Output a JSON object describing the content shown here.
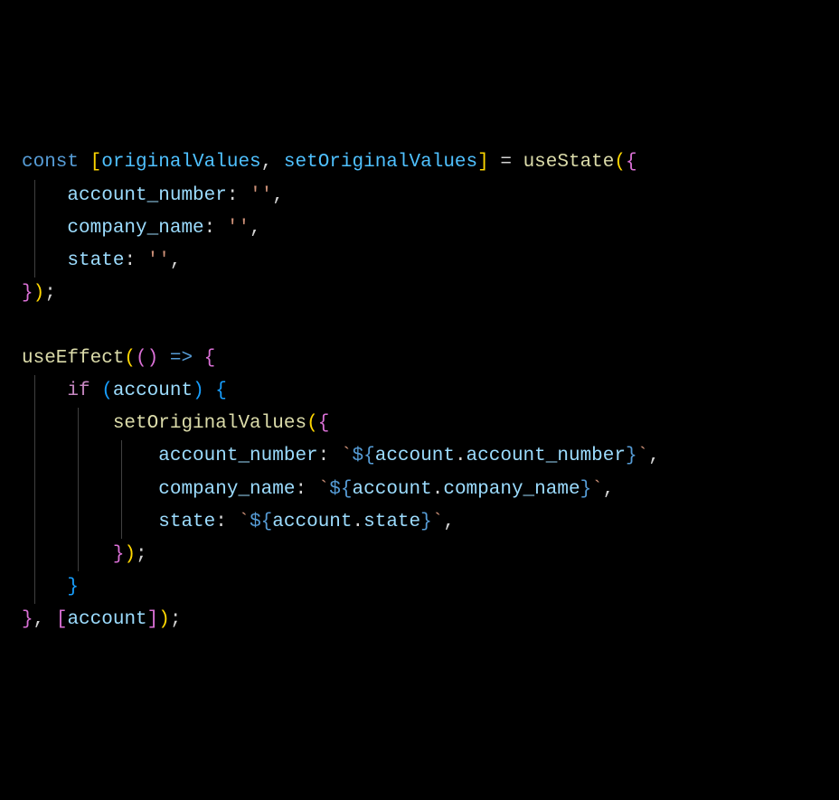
{
  "code": {
    "line1": {
      "kw_const": "const",
      "bracket_open": "[",
      "var1": "originalValues",
      "comma": ", ",
      "var2": "setOriginalValues",
      "bracket_close": "]",
      "equals": " = ",
      "func": "useState",
      "paren_open": "(",
      "brace_open": "{"
    },
    "line2": {
      "prop": "account_number",
      "colon": ": ",
      "val": "''",
      "comma": ","
    },
    "line3": {
      "prop": "company_name",
      "colon": ": ",
      "val": "''",
      "comma": ","
    },
    "line4": {
      "prop": "state",
      "colon": ": ",
      "val": "''",
      "comma": ","
    },
    "line5": {
      "brace_close": "}",
      "paren_close": ")",
      "semi": ";"
    },
    "line7": {
      "func": "useEffect",
      "paren_open": "(",
      "paren2_open": "(",
      "paren2_close": ")",
      "arrow": " => ",
      "brace_open": "{"
    },
    "line8": {
      "kw_if": "if",
      "paren_open": "(",
      "var": "account",
      "paren_close": ")",
      "brace_open": "{"
    },
    "line9": {
      "func": "setOriginalValues",
      "paren_open": "(",
      "brace_open": "{"
    },
    "line10": {
      "prop": "account_number",
      "colon": ": ",
      "tick_open": "`",
      "dollar_brace": "${",
      "obj": "account",
      "dot": ".",
      "member": "account_number",
      "brace_close": "}",
      "tick_close": "`",
      "comma": ","
    },
    "line11": {
      "prop": "company_name",
      "colon": ": ",
      "tick_open": "`",
      "dollar_brace": "${",
      "obj": "account",
      "dot": ".",
      "member": "company_name",
      "brace_close": "}",
      "tick_close": "`",
      "comma": ","
    },
    "line12": {
      "prop": "state",
      "colon": ": ",
      "tick_open": "`",
      "dollar_brace": "${",
      "obj": "account",
      "dot": ".",
      "member": "state",
      "brace_close": "}",
      "tick_close": "`",
      "comma": ","
    },
    "line13": {
      "brace_close": "}",
      "paren_close": ")",
      "semi": ";"
    },
    "line14": {
      "brace_close": "}"
    },
    "line15": {
      "brace_close": "}",
      "comma": ", ",
      "bracket_open": "[",
      "var": "account",
      "bracket_close": "]",
      "paren_close": ")",
      "semi": ";"
    }
  }
}
